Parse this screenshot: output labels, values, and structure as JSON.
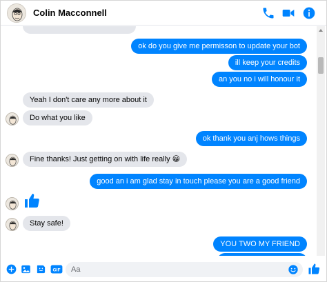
{
  "header": {
    "contact_name": "Colin Macconnell"
  },
  "messages": [
    {
      "dir": "in",
      "text": "",
      "partial": true
    },
    {
      "dir": "out",
      "text": "ok  do you give me permisson to update your bot"
    },
    {
      "dir": "out",
      "text": "ill keep your credits"
    },
    {
      "dir": "out",
      "text": "an you no i will honour it"
    },
    {
      "dir": "in",
      "text": "Yeah I don't care any more about it"
    },
    {
      "dir": "in",
      "text": "Do what you like"
    },
    {
      "dir": "out",
      "text": "ok thank you anj hows things"
    },
    {
      "dir": "in",
      "text": "Fine thanks! Just getting on with life really 😀"
    },
    {
      "dir": "out",
      "text": "good  an i am glad stay in touch please you are a good friend"
    },
    {
      "dir": "in",
      "text": "",
      "like": true
    },
    {
      "dir": "in",
      "text": "Stay safe!"
    },
    {
      "dir": "out",
      "text": "YOU TWO MY FRIEND"
    }
  ],
  "composer": {
    "placeholder": "Aa"
  },
  "icons": {
    "accent": "#0084ff",
    "header": [
      "phone-icon",
      "video-camera-icon",
      "info-icon"
    ],
    "composer": [
      "plus-icon",
      "image-icon",
      "sticker-icon",
      "gif-icon",
      "emoji-icon",
      "thumbs-up-icon"
    ]
  }
}
